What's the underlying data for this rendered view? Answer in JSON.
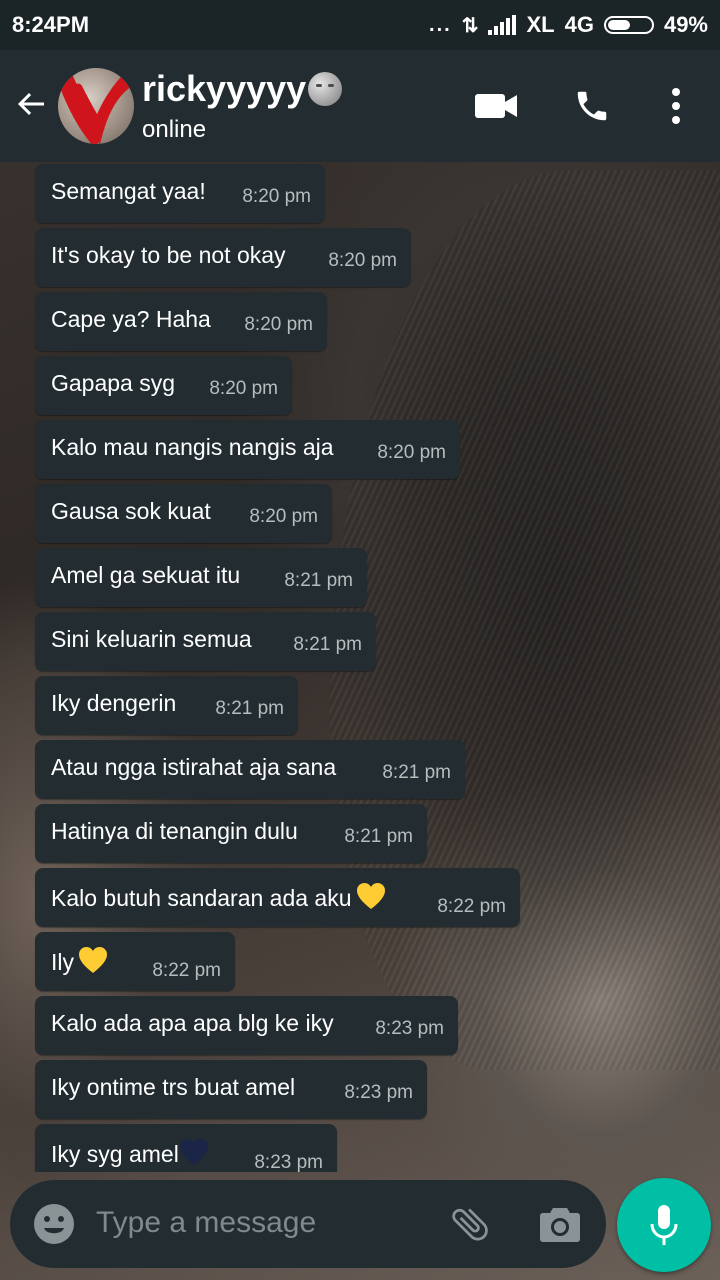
{
  "status_bar": {
    "time": "8:24PM",
    "dots": "...",
    "carrier": "XL",
    "network": "4G",
    "battery": "49%"
  },
  "header": {
    "contact_name": "rickyyyyy",
    "contact_status": "online",
    "icons": [
      "back-arrow-icon",
      "video-call-icon",
      "phone-icon",
      "more-vert-icon"
    ]
  },
  "messages": [
    {
      "text": "Semangat yaa!",
      "time": "8:20 pm"
    },
    {
      "text": "It's okay to be not okay",
      "time": "8:20 pm"
    },
    {
      "text": "Cape ya? Haha",
      "time": "8:20 pm"
    },
    {
      "text": "Gapapa syg",
      "time": "8:20 pm"
    },
    {
      "text": "Kalo mau nangis nangis aja",
      "time": "8:20 pm"
    },
    {
      "text": "Gausa sok kuat",
      "time": "8:20 pm"
    },
    {
      "text": "Amel ga sekuat itu",
      "time": "8:21 pm"
    },
    {
      "text": "Sini keluarin semua",
      "time": "8:21 pm"
    },
    {
      "text": "Iky dengerin",
      "time": "8:21 pm"
    },
    {
      "text": "Atau ngga istirahat aja sana",
      "time": "8:21 pm"
    },
    {
      "text": "Hatinya di tenangin dulu",
      "time": "8:21 pm"
    },
    {
      "text": "Kalo butuh sandaran ada aku",
      "time": "8:22 pm",
      "emoji": "yellow-heart-icon"
    },
    {
      "text": "Ily",
      "time": "8:22 pm",
      "emoji": "yellow-heart-icon"
    },
    {
      "text": "Kalo ada apa apa blg ke iky",
      "time": "8:23 pm"
    },
    {
      "text": "Iky ontime trs buat amel",
      "time": "8:23 pm"
    },
    {
      "text": "Iky syg amel",
      "time": "8:23 pm",
      "emoji": "dark-blue-heart-icon"
    }
  ],
  "input": {
    "placeholder": "Type a message",
    "icons": [
      "emoji-icon",
      "attach-icon",
      "camera-icon",
      "mic-icon"
    ]
  },
  "colors": {
    "header_bg": "#232d31",
    "bubble_bg": "#232d31",
    "accent": "#00bfa5",
    "yellow_heart": "#ffcc33",
    "dark_heart": "#1a2547"
  }
}
